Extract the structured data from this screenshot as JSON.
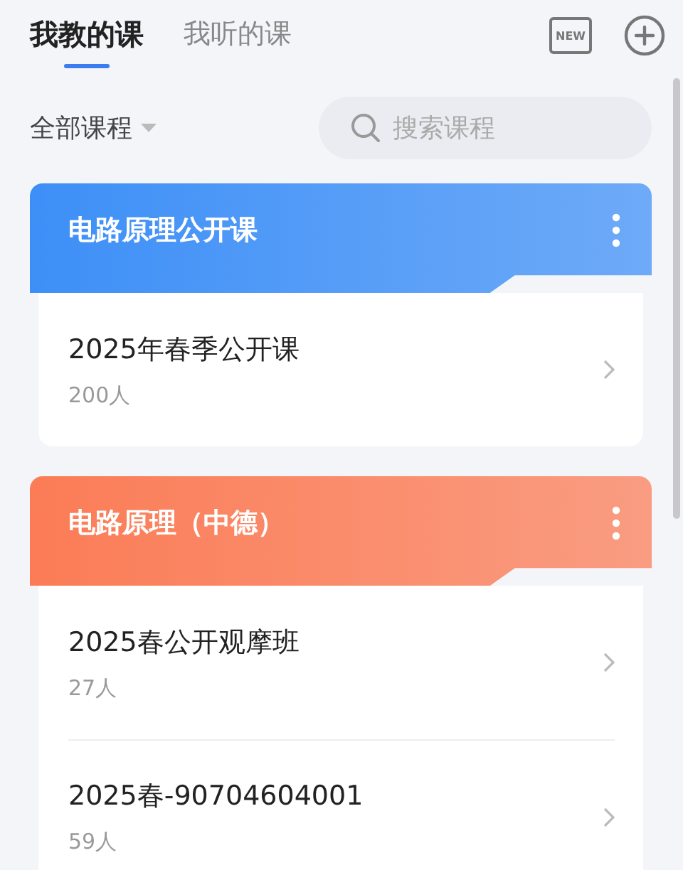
{
  "tabs": [
    {
      "label": "我教的课",
      "selected": true
    },
    {
      "label": "我听的课",
      "selected": false
    }
  ],
  "new_badge": "NEW",
  "filter": {
    "label": "全部课程"
  },
  "search": {
    "placeholder": "搜索课程"
  },
  "courses": [
    {
      "title": "电路原理公开课",
      "color": "#3d8ff7",
      "classes": [
        {
          "name": "2025年春季公开课",
          "count": "200人"
        }
      ]
    },
    {
      "title": "电路原理（中德）",
      "color": "#fb7c56",
      "classes": [
        {
          "name": "2025春公开观摩班",
          "count": "27人"
        },
        {
          "name": "2025春-90704604001",
          "count": "59人"
        }
      ]
    }
  ]
}
